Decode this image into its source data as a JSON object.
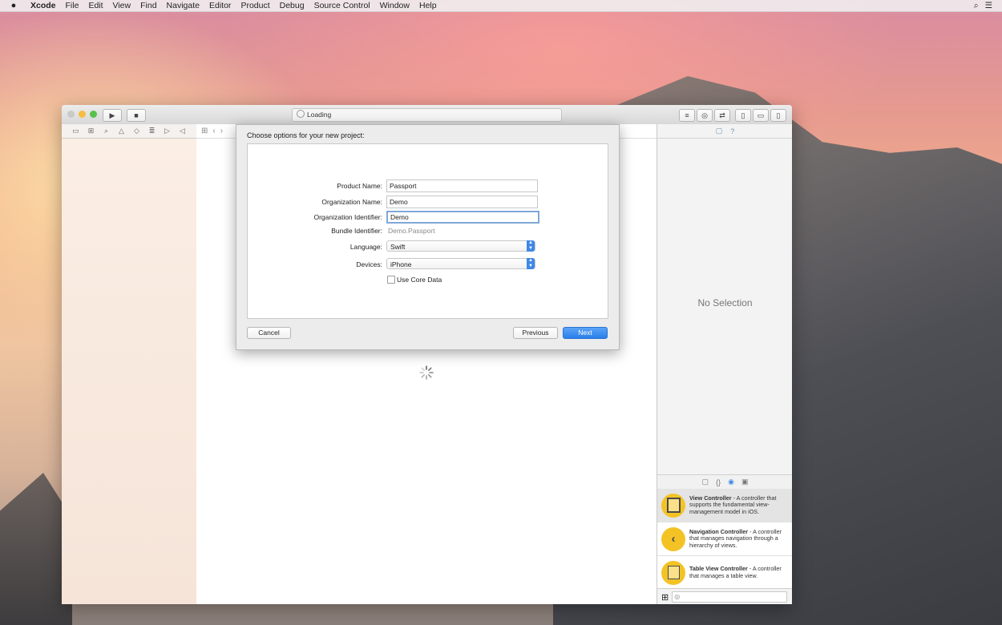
{
  "menubar": {
    "apple": "",
    "items": [
      "Xcode",
      "File",
      "Edit",
      "View",
      "Find",
      "Navigate",
      "Editor",
      "Product",
      "Debug",
      "Source Control",
      "Window",
      "Help"
    ]
  },
  "window": {
    "activity_text": "Loading"
  },
  "sheet": {
    "title": "Choose options for your new project:",
    "product_name_label": "Product Name:",
    "product_name_value": "Passport",
    "org_name_label": "Organization Name:",
    "org_name_value": "Demo",
    "org_id_label": "Organization Identifier:",
    "org_id_value": "Demo",
    "bundle_id_label": "Bundle Identifier:",
    "bundle_id_value": "Demo.Passport",
    "language_label": "Language:",
    "language_value": "Swift",
    "devices_label": "Devices:",
    "devices_value": "iPhone",
    "core_data_label": "Use Core Data",
    "cancel_label": "Cancel",
    "previous_label": "Previous",
    "next_label": "Next"
  },
  "inspector": {
    "no_selection": "No Selection"
  },
  "library": {
    "items": [
      {
        "title": "View Controller",
        "desc": " - A controller that supports the fundamental view-management model in iOS."
      },
      {
        "title": "Navigation Controller",
        "desc": " - A controller that manages navigation through a hierarchy of views."
      },
      {
        "title": "Table View Controller",
        "desc": " - A controller that manages a table view."
      }
    ]
  },
  "colors": {
    "accent": "#2b7fe9",
    "library_icon": "#f3c326"
  }
}
